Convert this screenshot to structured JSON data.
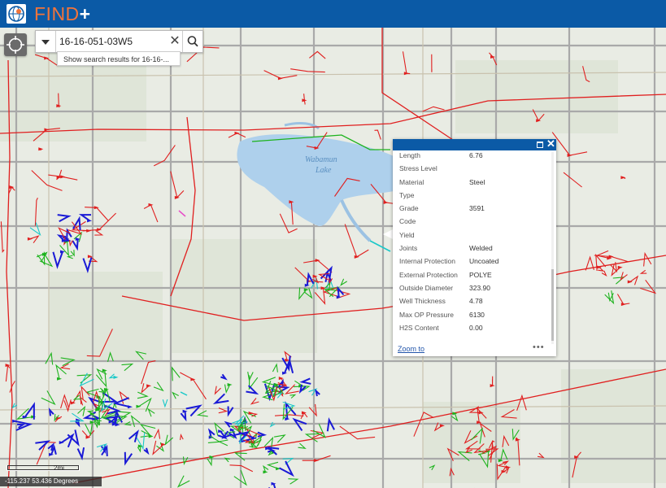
{
  "app": {
    "title_main": "FIND",
    "title_plus": "+",
    "logo_icon": "globe-logo-icon",
    "bar_color": "#0b5aa6",
    "title_color": "#f2743a"
  },
  "map": {
    "locate_icon": "locate-crosshair-icon",
    "lake_label_line1": "Wabamun",
    "lake_label_line2": "Lake",
    "pipeline_colors": [
      "#e01f1f",
      "#1db31d",
      "#1a1ad6",
      "#1ac8c8",
      "#e64ec8"
    ]
  },
  "search": {
    "value": "16-16-051-03W5",
    "dropdown_icon": "caret-down-icon",
    "clear_icon": "clear-x-icon",
    "search_icon": "search-icon",
    "suggestion": "Show search results for 16-16-..."
  },
  "popup": {
    "rows": [
      {
        "label": "Length",
        "value": "6.76"
      },
      {
        "label": "Stress Level",
        "value": ""
      },
      {
        "label": "Material",
        "value": "Steel"
      },
      {
        "label": "Type",
        "value": ""
      },
      {
        "label": "Grade",
        "value": "3591"
      },
      {
        "label": "Code",
        "value": ""
      },
      {
        "label": "Yield",
        "value": ""
      },
      {
        "label": "Joints",
        "value": "Welded"
      },
      {
        "label": "Internal Protection",
        "value": "Uncoated"
      },
      {
        "label": "External Protection",
        "value": "POLYE"
      },
      {
        "label": "Outside Diameter",
        "value": "323.90"
      },
      {
        "label": "Well Thickness",
        "value": "4.78"
      },
      {
        "label": "Max OP Pressure",
        "value": "6130"
      },
      {
        "label": "H2S Content",
        "value": "0.00"
      }
    ],
    "zoom_label": "Zoom to",
    "more_label": "•••",
    "maximize_icon": "maximize-icon",
    "close_icon": "close-icon"
  },
  "scale": {
    "label": "2mi"
  },
  "coords": {
    "text": "-115.237 53.436 Degrees"
  }
}
